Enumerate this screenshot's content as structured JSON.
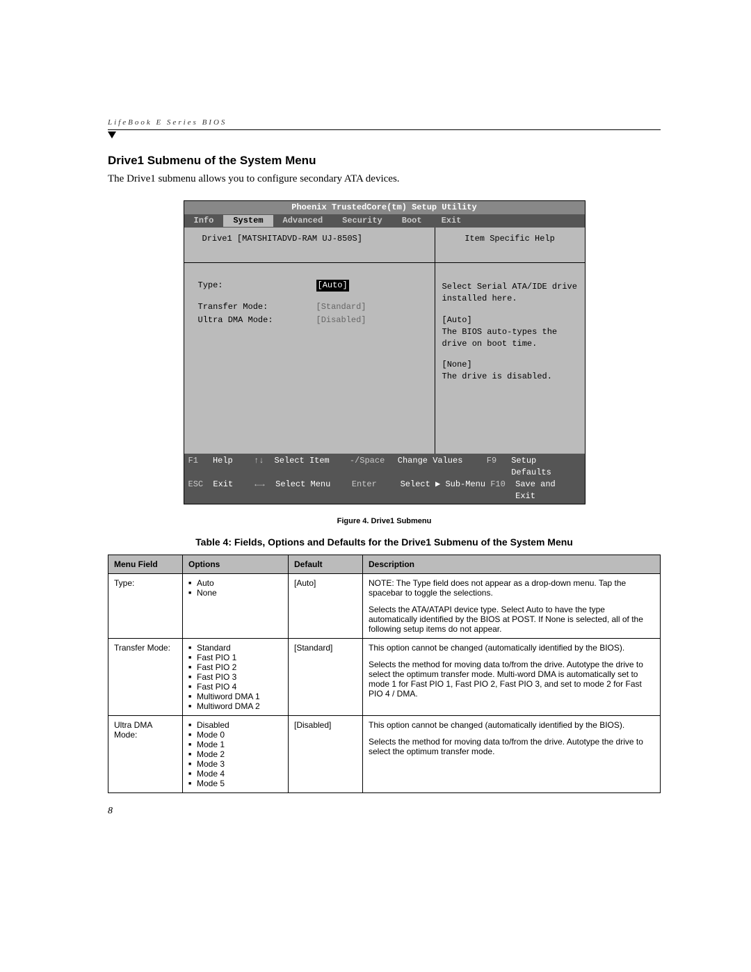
{
  "header": "LifeBook E Series BIOS",
  "title": "Drive1 Submenu of the System Menu",
  "intro": "The Drive1 submenu allows you to configure secondary ATA devices.",
  "bios": {
    "utility_title": "Phoenix TrustedCore(tm) Setup Utility",
    "menus": [
      "Info",
      "System",
      "Advanced",
      "Security",
      "Boot",
      "Exit"
    ],
    "active_menu": "System",
    "submenu_title": "Drive1 [MATSHITADVD-RAM UJ-850S]",
    "help_header": "Item Specific Help",
    "fields": [
      {
        "label": "Type:",
        "value": "[Auto]",
        "selected": true
      },
      {
        "label": "Transfer Mode:",
        "value": "[Standard]",
        "dim": true
      },
      {
        "label": "Ultra DMA Mode:",
        "value": "[Disabled]",
        "dim": true
      }
    ],
    "help": {
      "p1": "Select Serial ATA/IDE drive installed here.",
      "p2a": "[Auto]",
      "p2b": "The BIOS auto-types the drive on boot time.",
      "p3a": "[None]",
      "p3b": "The drive is disabled."
    },
    "footer": {
      "f1": "F1",
      "help": "Help",
      "arrows_ud": "↑↓",
      "select_item": "Select Item",
      "spc": "-/Space",
      "change": "Change Values",
      "f9": "F9",
      "defaults": "Setup Defaults",
      "esc": "ESC",
      "exit": "Exit",
      "arrows_lr": "←→",
      "select_menu": "Select Menu",
      "enter": "Enter",
      "submenu": "Select ▶ Sub-Menu",
      "f10": "F10",
      "save": "Save and Exit"
    }
  },
  "figure_caption": "Figure 4.  Drive1 Submenu",
  "table_title": "Table 4: Fields, Options and Defaults for the Drive1 Submenu of the System Menu",
  "table": {
    "headers": [
      "Menu Field",
      "Options",
      "Default",
      "Description"
    ],
    "rows": [
      {
        "field": "Type:",
        "options": [
          "Auto",
          "None"
        ],
        "default": "[Auto]",
        "desc": [
          "NOTE: The Type field does not appear as a drop-down menu. Tap the spacebar to toggle the selections.",
          "Selects the ATA/ATAPI device type. Select Auto to have the type automatically identified by the BIOS at POST. If None is selected, all of the following setup items do not appear."
        ]
      },
      {
        "field": "Transfer Mode:",
        "options": [
          "Standard",
          "Fast PIO 1",
          "Fast PIO 2",
          "Fast PIO 3",
          "Fast PIO 4",
          "Multiword DMA 1",
          "Multiword DMA 2"
        ],
        "default": "[Standard]",
        "desc": [
          "This option cannot be changed (automatically identified by the BIOS).",
          "Selects the method for moving data to/from the drive. Autotype the drive to select the optimum transfer mode.  Multi-word DMA is automatically set to mode 1 for Fast PIO 1, Fast PIO 2, Fast PIO 3, and set to mode 2 for Fast PIO 4 / DMA."
        ]
      },
      {
        "field": "Ultra DMA Mode:",
        "options": [
          "Disabled",
          "Mode 0",
          "Mode 1",
          "Mode 2",
          "Mode 3",
          "Mode 4",
          "Mode 5"
        ],
        "default": "[Disabled]",
        "desc": [
          "This option cannot be changed (automatically identified by the BIOS).",
          "Selects the method for moving data to/from the drive. Autotype the drive to select the optimum transfer mode."
        ]
      }
    ]
  },
  "page_number": "8"
}
